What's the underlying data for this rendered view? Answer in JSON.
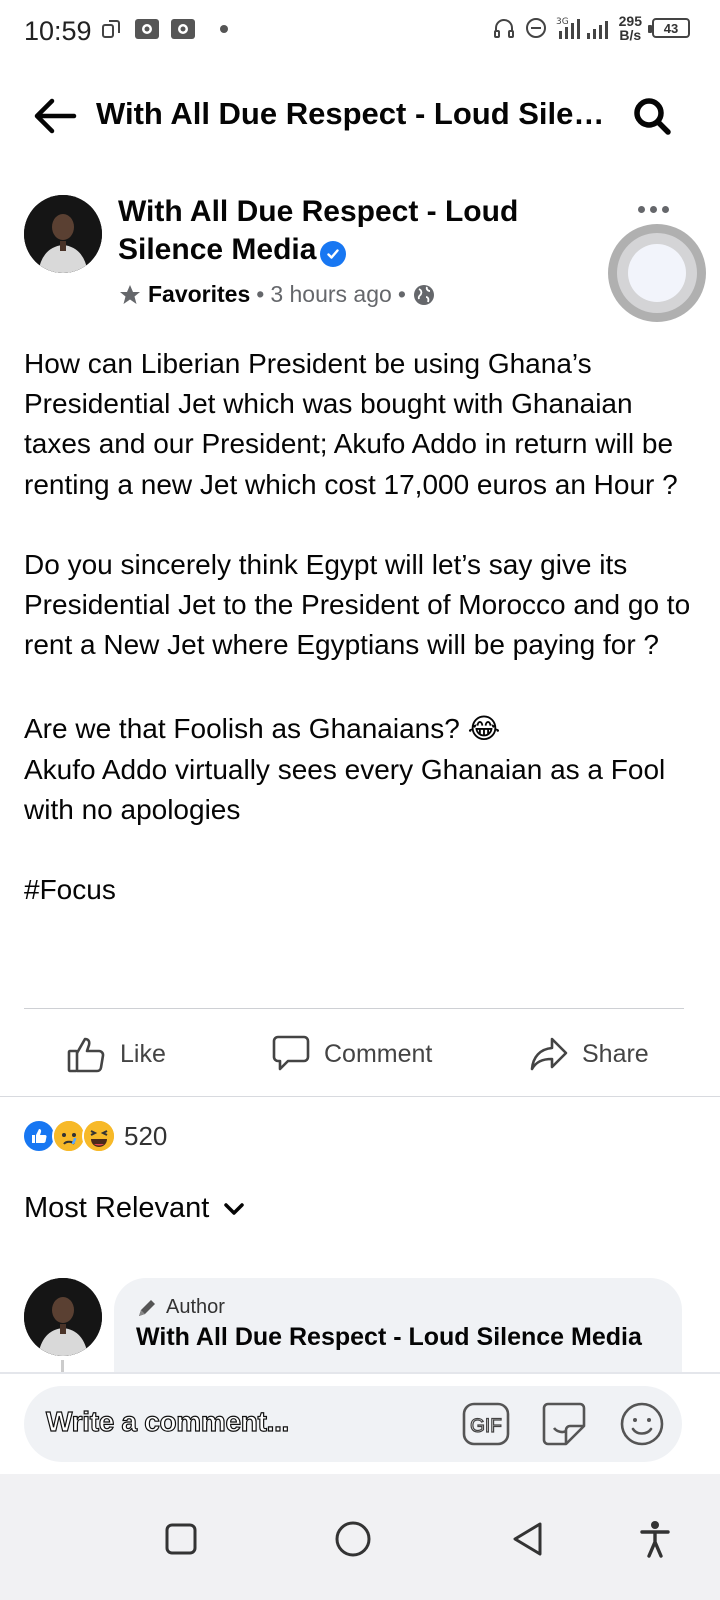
{
  "status_bar": {
    "time": "10:59",
    "net_speed_value": "295",
    "net_speed_unit": "B/s",
    "network": "3G",
    "battery": "43",
    "icons": [
      "sync-icon",
      "notification-icon",
      "notification-icon",
      "headphones-icon",
      "dnd-icon",
      "signal-icon",
      "battery-icon"
    ]
  },
  "header": {
    "title": "With All Due Respect - Loud Silence Media",
    "back_icon": "back-arrow-icon",
    "search_icon": "search-icon"
  },
  "post": {
    "author": "With All Due Respect - Loud Silence Media",
    "verified": true,
    "favorites_label": "Favorites",
    "time": "3 hours ago",
    "privacy_icon": "globe-icon",
    "paragraphs": [
      "How can Liberian President be using Ghana’s Presidential Jet which was bought with Ghanaian taxes and our President; Akufo Addo in return will be renting a new Jet which cost 17,000 euros an Hour ?",
      "Do you sincerely think Egypt will let’s say give its Presidential Jet to the President of Morocco and go to rent a New Jet where Egyptians will be paying for ?",
      "Are we that Foolish as Ghanaians? 😂",
      "Akufo Addo virtually sees every Ghanaian as a Fool with no apologies",
      "#Focus"
    ]
  },
  "actions": {
    "like": "Like",
    "comment": "Comment",
    "share": "Share"
  },
  "reactions": {
    "types": [
      "like",
      "sad",
      "haha"
    ],
    "count": "520"
  },
  "comments": {
    "sort_label": "Most Relevant",
    "first": {
      "badge": "Author",
      "author": "With All Due Respect - Loud Silence Media"
    }
  },
  "composer": {
    "placeholder": "Write a comment...",
    "gif_label": "GIF"
  },
  "colors": {
    "brand_blue": "#1877f2",
    "text_primary": "#050505",
    "text_secondary": "#65676b",
    "bubble_bg": "#f0f2f5"
  }
}
